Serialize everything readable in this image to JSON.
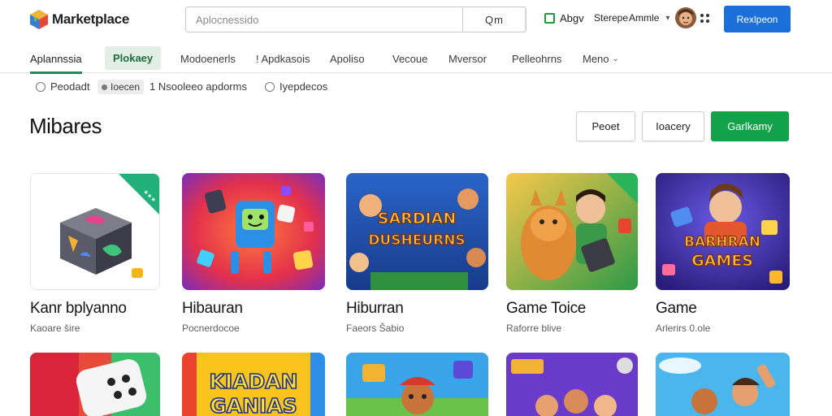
{
  "app": {
    "name": "Marketplace"
  },
  "search": {
    "placeholder": "Aplocnessido",
    "button_label": "Q m"
  },
  "header": {
    "apps_link": "Abgv",
    "store_link": "Sterepe Ammle",
    "primary_button": "Rexlpeon"
  },
  "nav": {
    "tabs": [
      {
        "label": "Aplannssia"
      },
      {
        "label": "Plokaey"
      },
      {
        "label": "Modoenerls"
      },
      {
        "label": "! Apdkasois"
      },
      {
        "label": "Apoliso"
      },
      {
        "label": "Vecoue"
      },
      {
        "label": "Mversor"
      },
      {
        "label": "Pelleohrns"
      },
      {
        "label": "Meno"
      }
    ]
  },
  "filters": {
    "items": [
      {
        "label": "Peodadt"
      },
      {
        "label": "Ioecen"
      },
      {
        "label": "1 Nsooleeo apdorms"
      },
      {
        "label": "Iyepdecos"
      }
    ]
  },
  "page": {
    "title": "Mibares",
    "buttons": {
      "reset": "Peoet",
      "secondary": "Ioacery",
      "primary": "Garlkamy"
    }
  },
  "cards": [
    {
      "title": "Kanr bplyanno",
      "subtitle": "Kaoare šire",
      "thumb_text": ""
    },
    {
      "title": "Hibauran",
      "subtitle": "Pocnerdocoe",
      "thumb_text": ""
    },
    {
      "title": "Hiburran",
      "subtitle": "Faeors Šabio",
      "thumb_text": "SARDIAN DUSHEURNS"
    },
    {
      "title": "Game Toice",
      "subtitle": "Raforre blive",
      "thumb_text": ""
    },
    {
      "title": "Game",
      "subtitle": "Arlerirs 0.ole",
      "thumb_text": "BARHRAN GAMES"
    },
    {
      "title": "",
      "subtitle": "",
      "thumb_text": ""
    },
    {
      "title": "",
      "subtitle": "",
      "thumb_text": "KIADAN GANIAS"
    },
    {
      "title": "",
      "subtitle": "",
      "thumb_text": ""
    },
    {
      "title": "",
      "subtitle": "",
      "thumb_text": ""
    },
    {
      "title": "",
      "subtitle": "",
      "thumb_text": ""
    }
  ],
  "colors": {
    "accent_blue": "#1a6fd8",
    "accent_green": "#12a24a",
    "tab_underline": "#1a8f5a"
  },
  "icons": {
    "logo": "cube-logo-icon",
    "search": "search-icon",
    "apps": "apps-square-icon",
    "menu": "dots-icon"
  }
}
